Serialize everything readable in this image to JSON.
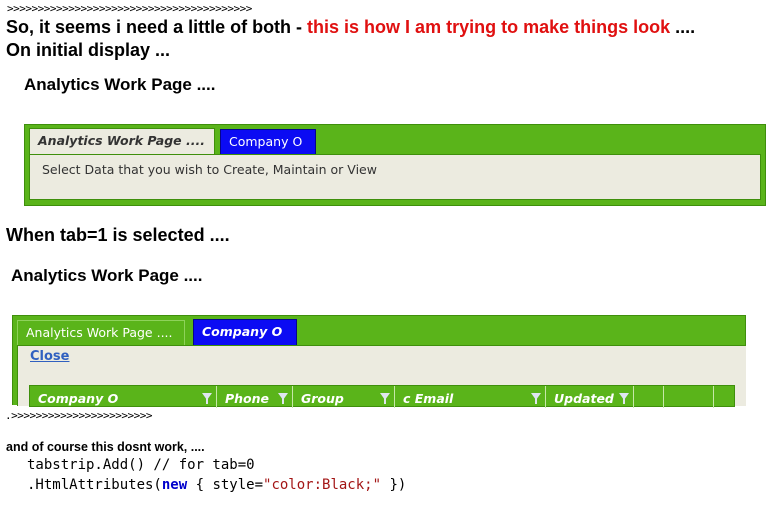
{
  "intro": {
    "arrows_top": ">>>>>>>>>>>>>>>>>>>>>>>>>>>>>>>>>>>>>>>>",
    "line1_black": "So, it seems i need a little of both - ",
    "line1_red": "this is how I am trying to make things look",
    "line1_end": " ....",
    "line2": "On initial display ..."
  },
  "example1": {
    "page_title": "Analytics Work Page ....",
    "tabs": [
      {
        "label": "Analytics Work Page ....",
        "state": "active"
      },
      {
        "label": "Company O",
        "state": "inactive"
      }
    ],
    "content_text": "Select Data that you wish to Create, Maintain or View"
  },
  "middle": {
    "tab1_heading": "When tab=1 is selected ...."
  },
  "example2": {
    "page_title": "Analytics Work Page ....",
    "tabs": [
      {
        "label": "Analytics Work Page ....",
        "state": "inactive"
      },
      {
        "label": "Company O",
        "state": "active"
      }
    ],
    "close_link": "Close",
    "grid_columns": [
      "Company O",
      "Phone",
      "Group",
      "c Email",
      "Updated",
      "",
      ""
    ]
  },
  "footer": {
    "arrows_bottom": ".>>>>>>>>>>>>>>>>>>>>>>>",
    "note": "and of course this dosnt work,  ....",
    "code_line1": "tabstrip.Add()  // for tab=0",
    "code_line2_pre": ".HtmlAttributes(",
    "code_line2_kw": "new",
    "code_line2_mid": " { style=",
    "code_line2_str": "\"color:Black;\"",
    "code_line2_end": " })"
  },
  "colors": {
    "tab_green": "#5ab41a",
    "tab_blue": "#0b0bf3",
    "content_bg": "#ecebe0",
    "highlight_red": "#e01010"
  }
}
